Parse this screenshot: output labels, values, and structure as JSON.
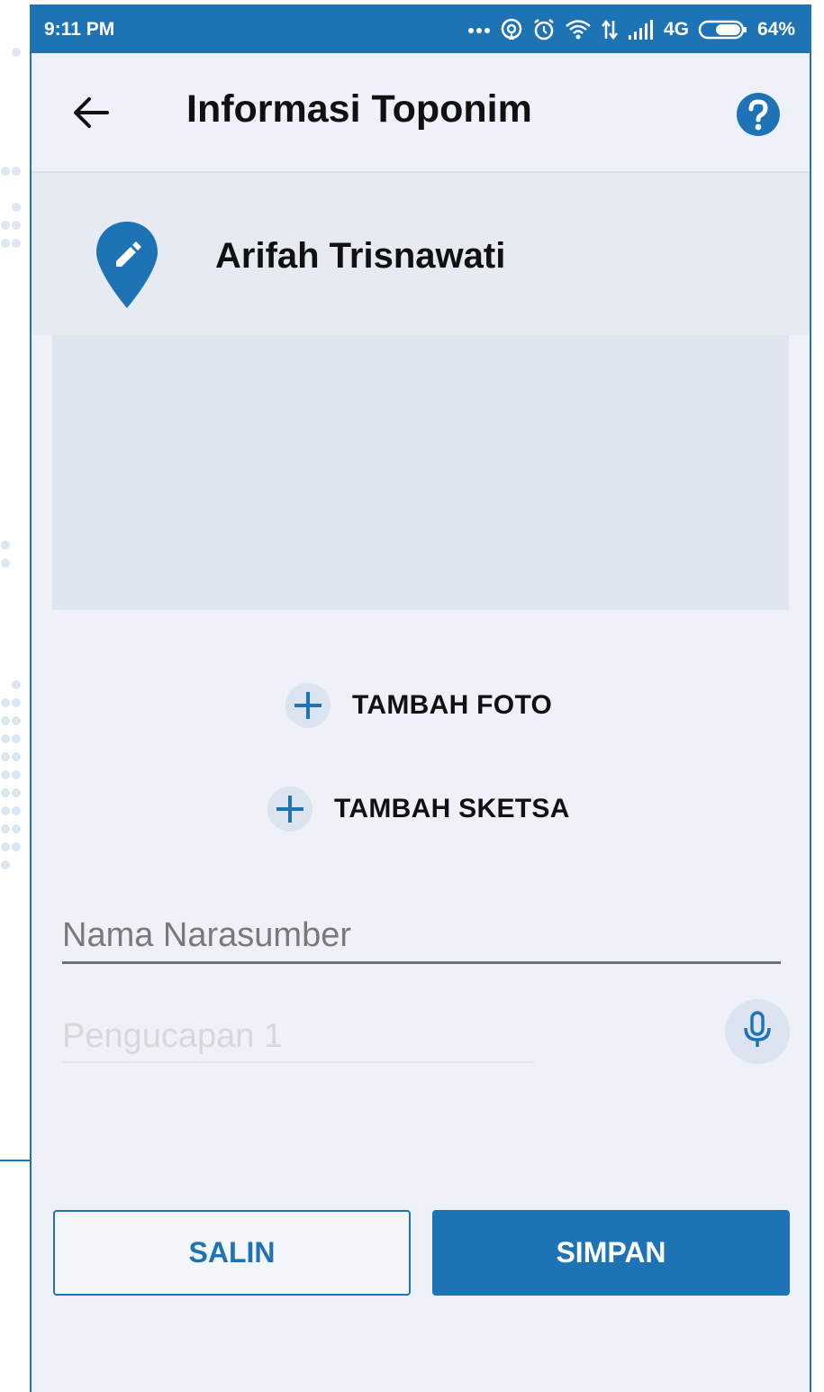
{
  "status_bar": {
    "time": "9:11 PM",
    "network": "4G",
    "battery": "64%",
    "icons": [
      "more-dots-icon",
      "hotspot-icon",
      "alarm-icon",
      "wifi-icon",
      "data-transfer-icon",
      "signal-icon",
      "battery-icon"
    ]
  },
  "appbar": {
    "title": "Informasi Toponim",
    "back_icon": "arrow-left-icon",
    "help_icon": "help-circle-icon"
  },
  "user": {
    "name": "Arifah Trisnawati",
    "icon": "map-pin-edit-icon"
  },
  "actions": {
    "add_photo_label": "TAMBAH FOTO",
    "add_sketch_label": "TAMBAH SKETSA"
  },
  "form": {
    "narasumber_placeholder": "Nama Narasumber",
    "narasumber_value": "",
    "pengucapan_placeholder": "Pengucapan 1",
    "pengucapan_value": "",
    "mic_icon": "microphone-icon"
  },
  "buttons": {
    "copy_label": "SALIN",
    "save_label": "SIMPAN"
  },
  "colors": {
    "primary": "#1e73b5",
    "background": "#eef2f8",
    "photo_placeholder": "#dfe6ef"
  }
}
